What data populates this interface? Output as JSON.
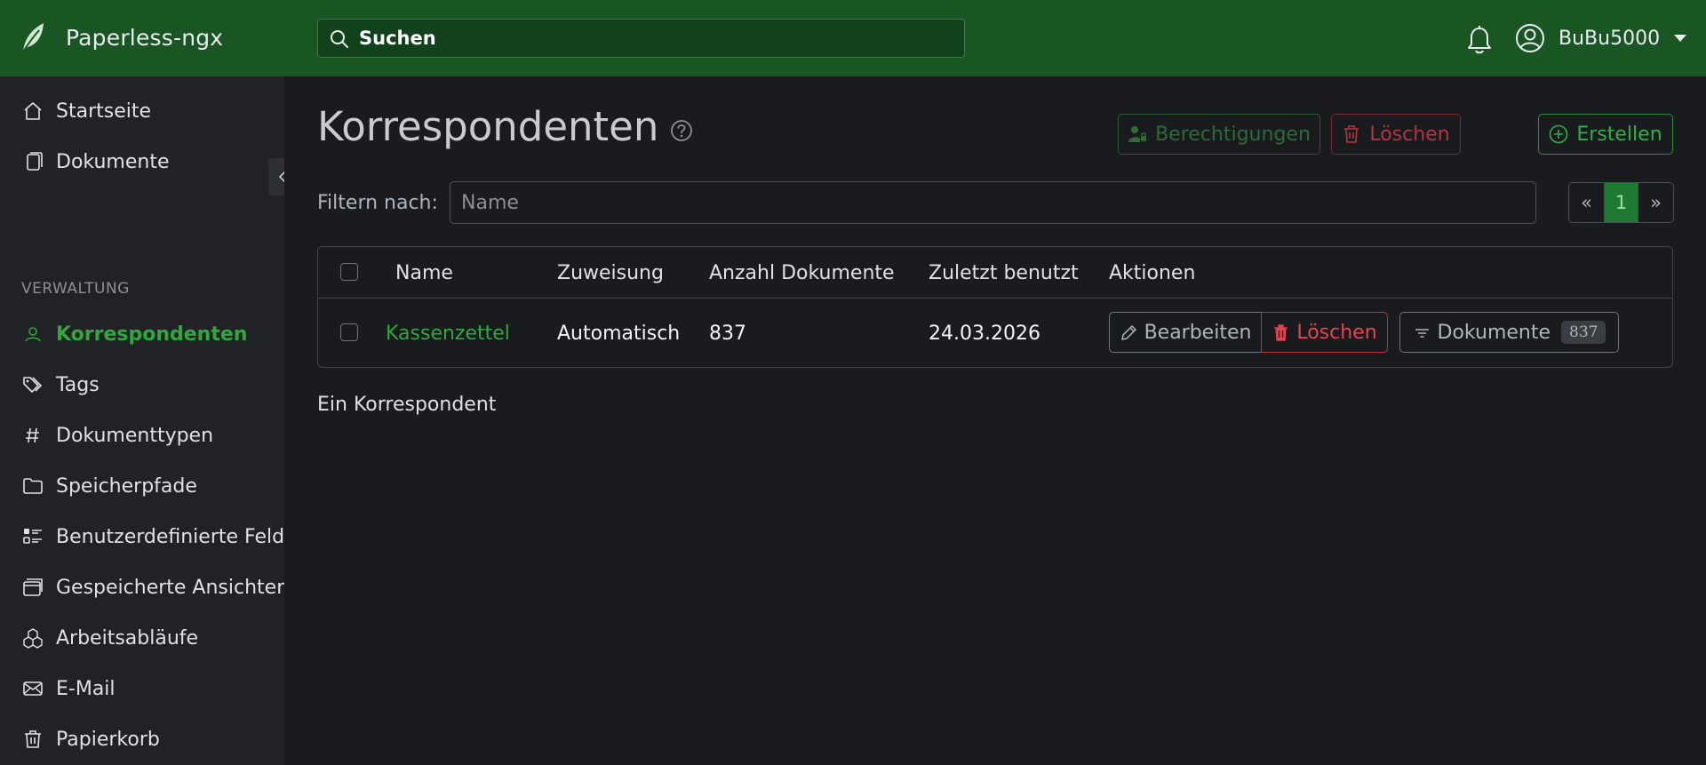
{
  "app": {
    "title": "Paperless-ngx",
    "accent": "#1a5524",
    "link_color": "#2fa83e",
    "danger_color": "#b4363f"
  },
  "header": {
    "search_placeholder": "Suchen",
    "notifications_icon": "bell-icon",
    "user_name": "BuBu5000"
  },
  "sidebar": {
    "items": [
      {
        "label": "Startseite",
        "icon": "house-icon"
      },
      {
        "label": "Dokumente",
        "icon": "files-icon"
      }
    ],
    "section_title": "VERWALTUNG",
    "admin_items": [
      {
        "label": "Korrespondenten",
        "icon": "person-icon",
        "active": true
      },
      {
        "label": "Tags",
        "icon": "tags-icon"
      },
      {
        "label": "Dokumenttypen",
        "icon": "hash-icon"
      },
      {
        "label": "Speicherpfade",
        "icon": "folder-icon"
      },
      {
        "label": "Benutzerdefinierte Felder",
        "icon": "list-ui-icon"
      },
      {
        "label": "Gespeicherte Ansichten",
        "icon": "window-stack-icon"
      },
      {
        "label": "Arbeitsabläufe",
        "icon": "boxes-icon"
      },
      {
        "label": "E-Mail",
        "icon": "envelope-icon"
      },
      {
        "label": "Papierkorb",
        "icon": "trash-icon"
      }
    ]
  },
  "main": {
    "title": "Korrespondenten",
    "buttons": {
      "permissions": "Berechtigungen",
      "delete": "Löschen",
      "create": "Erstellen"
    },
    "filter": {
      "label": "Filtern nach:",
      "placeholder": "Name"
    },
    "pagination": {
      "prev": "«",
      "current": "1",
      "next": "»"
    },
    "table": {
      "columns": [
        "Name",
        "Zuweisung",
        "Anzahl Dokumente",
        "Zuletzt benutzt",
        "Aktionen"
      ],
      "rows": [
        {
          "name": "Kassenzettel",
          "assignment": "Automatisch",
          "doc_count": "837",
          "last_used": "24.03.2026",
          "actions": {
            "edit": "Bearbeiten",
            "delete": "Löschen",
            "documents": "Dokumente",
            "documents_badge": "837"
          }
        }
      ]
    },
    "footer": "Ein Korrespondent"
  }
}
